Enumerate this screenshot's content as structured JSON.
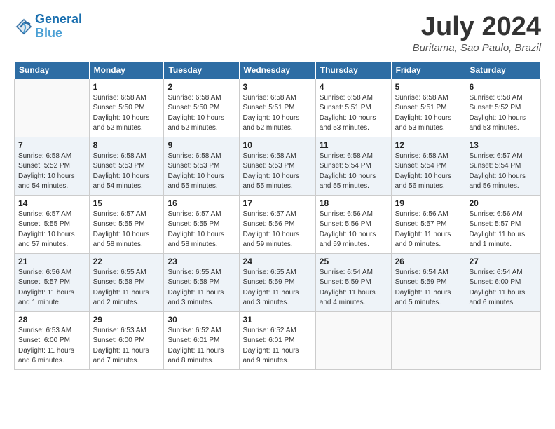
{
  "header": {
    "logo_line1": "General",
    "logo_line2": "Blue",
    "month_title": "July 2024",
    "location": "Buritama, Sao Paulo, Brazil"
  },
  "weekdays": [
    "Sunday",
    "Monday",
    "Tuesday",
    "Wednesday",
    "Thursday",
    "Friday",
    "Saturday"
  ],
  "weeks": [
    [
      {
        "day": "",
        "sunrise": "",
        "sunset": "",
        "daylight": ""
      },
      {
        "day": "1",
        "sunrise": "Sunrise: 6:58 AM",
        "sunset": "Sunset: 5:50 PM",
        "daylight": "Daylight: 10 hours and 52 minutes."
      },
      {
        "day": "2",
        "sunrise": "Sunrise: 6:58 AM",
        "sunset": "Sunset: 5:50 PM",
        "daylight": "Daylight: 10 hours and 52 minutes."
      },
      {
        "day": "3",
        "sunrise": "Sunrise: 6:58 AM",
        "sunset": "Sunset: 5:51 PM",
        "daylight": "Daylight: 10 hours and 52 minutes."
      },
      {
        "day": "4",
        "sunrise": "Sunrise: 6:58 AM",
        "sunset": "Sunset: 5:51 PM",
        "daylight": "Daylight: 10 hours and 53 minutes."
      },
      {
        "day": "5",
        "sunrise": "Sunrise: 6:58 AM",
        "sunset": "Sunset: 5:51 PM",
        "daylight": "Daylight: 10 hours and 53 minutes."
      },
      {
        "day": "6",
        "sunrise": "Sunrise: 6:58 AM",
        "sunset": "Sunset: 5:52 PM",
        "daylight": "Daylight: 10 hours and 53 minutes."
      }
    ],
    [
      {
        "day": "7",
        "sunrise": "Sunrise: 6:58 AM",
        "sunset": "Sunset: 5:52 PM",
        "daylight": "Daylight: 10 hours and 54 minutes."
      },
      {
        "day": "8",
        "sunrise": "Sunrise: 6:58 AM",
        "sunset": "Sunset: 5:53 PM",
        "daylight": "Daylight: 10 hours and 54 minutes."
      },
      {
        "day": "9",
        "sunrise": "Sunrise: 6:58 AM",
        "sunset": "Sunset: 5:53 PM",
        "daylight": "Daylight: 10 hours and 55 minutes."
      },
      {
        "day": "10",
        "sunrise": "Sunrise: 6:58 AM",
        "sunset": "Sunset: 5:53 PM",
        "daylight": "Daylight: 10 hours and 55 minutes."
      },
      {
        "day": "11",
        "sunrise": "Sunrise: 6:58 AM",
        "sunset": "Sunset: 5:54 PM",
        "daylight": "Daylight: 10 hours and 55 minutes."
      },
      {
        "day": "12",
        "sunrise": "Sunrise: 6:58 AM",
        "sunset": "Sunset: 5:54 PM",
        "daylight": "Daylight: 10 hours and 56 minutes."
      },
      {
        "day": "13",
        "sunrise": "Sunrise: 6:57 AM",
        "sunset": "Sunset: 5:54 PM",
        "daylight": "Daylight: 10 hours and 56 minutes."
      }
    ],
    [
      {
        "day": "14",
        "sunrise": "Sunrise: 6:57 AM",
        "sunset": "Sunset: 5:55 PM",
        "daylight": "Daylight: 10 hours and 57 minutes."
      },
      {
        "day": "15",
        "sunrise": "Sunrise: 6:57 AM",
        "sunset": "Sunset: 5:55 PM",
        "daylight": "Daylight: 10 hours and 58 minutes."
      },
      {
        "day": "16",
        "sunrise": "Sunrise: 6:57 AM",
        "sunset": "Sunset: 5:55 PM",
        "daylight": "Daylight: 10 hours and 58 minutes."
      },
      {
        "day": "17",
        "sunrise": "Sunrise: 6:57 AM",
        "sunset": "Sunset: 5:56 PM",
        "daylight": "Daylight: 10 hours and 59 minutes."
      },
      {
        "day": "18",
        "sunrise": "Sunrise: 6:56 AM",
        "sunset": "Sunset: 5:56 PM",
        "daylight": "Daylight: 10 hours and 59 minutes."
      },
      {
        "day": "19",
        "sunrise": "Sunrise: 6:56 AM",
        "sunset": "Sunset: 5:57 PM",
        "daylight": "Daylight: 11 hours and 0 minutes."
      },
      {
        "day": "20",
        "sunrise": "Sunrise: 6:56 AM",
        "sunset": "Sunset: 5:57 PM",
        "daylight": "Daylight: 11 hours and 1 minute."
      }
    ],
    [
      {
        "day": "21",
        "sunrise": "Sunrise: 6:56 AM",
        "sunset": "Sunset: 5:57 PM",
        "daylight": "Daylight: 11 hours and 1 minute."
      },
      {
        "day": "22",
        "sunrise": "Sunrise: 6:55 AM",
        "sunset": "Sunset: 5:58 PM",
        "daylight": "Daylight: 11 hours and 2 minutes."
      },
      {
        "day": "23",
        "sunrise": "Sunrise: 6:55 AM",
        "sunset": "Sunset: 5:58 PM",
        "daylight": "Daylight: 11 hours and 3 minutes."
      },
      {
        "day": "24",
        "sunrise": "Sunrise: 6:55 AM",
        "sunset": "Sunset: 5:59 PM",
        "daylight": "Daylight: 11 hours and 3 minutes."
      },
      {
        "day": "25",
        "sunrise": "Sunrise: 6:54 AM",
        "sunset": "Sunset: 5:59 PM",
        "daylight": "Daylight: 11 hours and 4 minutes."
      },
      {
        "day": "26",
        "sunrise": "Sunrise: 6:54 AM",
        "sunset": "Sunset: 5:59 PM",
        "daylight": "Daylight: 11 hours and 5 minutes."
      },
      {
        "day": "27",
        "sunrise": "Sunrise: 6:54 AM",
        "sunset": "Sunset: 6:00 PM",
        "daylight": "Daylight: 11 hours and 6 minutes."
      }
    ],
    [
      {
        "day": "28",
        "sunrise": "Sunrise: 6:53 AM",
        "sunset": "Sunset: 6:00 PM",
        "daylight": "Daylight: 11 hours and 6 minutes."
      },
      {
        "day": "29",
        "sunrise": "Sunrise: 6:53 AM",
        "sunset": "Sunset: 6:00 PM",
        "daylight": "Daylight: 11 hours and 7 minutes."
      },
      {
        "day": "30",
        "sunrise": "Sunrise: 6:52 AM",
        "sunset": "Sunset: 6:01 PM",
        "daylight": "Daylight: 11 hours and 8 minutes."
      },
      {
        "day": "31",
        "sunrise": "Sunrise: 6:52 AM",
        "sunset": "Sunset: 6:01 PM",
        "daylight": "Daylight: 11 hours and 9 minutes."
      },
      {
        "day": "",
        "sunrise": "",
        "sunset": "",
        "daylight": ""
      },
      {
        "day": "",
        "sunrise": "",
        "sunset": "",
        "daylight": ""
      },
      {
        "day": "",
        "sunrise": "",
        "sunset": "",
        "daylight": ""
      }
    ]
  ]
}
